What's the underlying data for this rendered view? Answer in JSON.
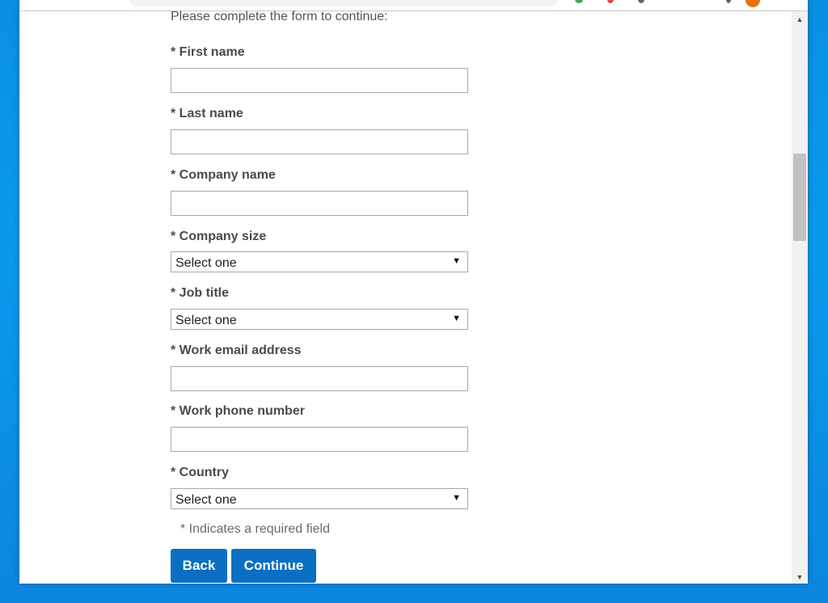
{
  "form": {
    "intro": "Please complete the form to continue:",
    "fields": {
      "first_name": {
        "label": "* First name",
        "value": ""
      },
      "last_name": {
        "label": "* Last name",
        "value": ""
      },
      "company_name": {
        "label": "* Company name",
        "value": ""
      },
      "company_size": {
        "label": "* Company size",
        "selected": "Select one"
      },
      "job_title": {
        "label": "* Job title",
        "selected": "Select one"
      },
      "work_email": {
        "label": "* Work email address",
        "value": ""
      },
      "work_phone": {
        "label": "* Work phone number",
        "value": ""
      },
      "country": {
        "label": "* Country",
        "selected": "Select one"
      }
    },
    "required_note": "* Indicates a required field",
    "buttons": {
      "back": "Back",
      "continue": "Continue"
    }
  },
  "icons": {
    "dropdown_arrow": "▼",
    "scroll_up": "▲",
    "scroll_down": "▼"
  },
  "colors": {
    "button": "#0a6fc2",
    "desktop": "#0a8fe0"
  }
}
